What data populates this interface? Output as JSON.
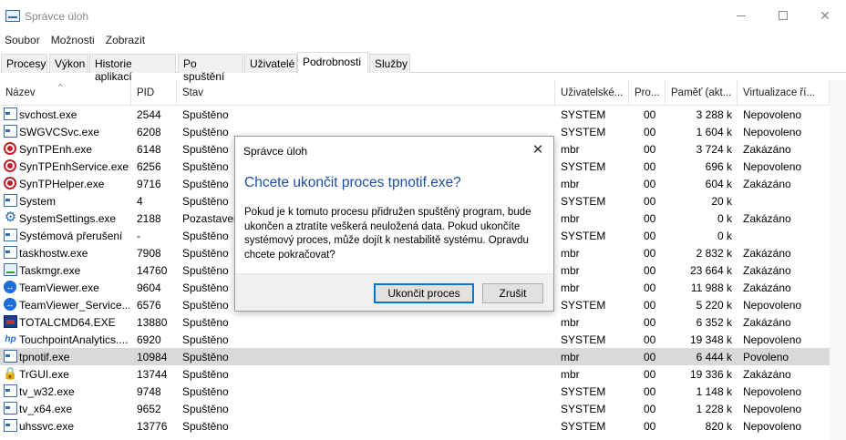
{
  "window": {
    "title": "Správce úloh",
    "icons": {
      "app": "task-manager-icon",
      "minimize": "minimize-icon",
      "maximize": "maximize-icon",
      "close": "close-icon"
    }
  },
  "menu": [
    "Soubor",
    "Možnosti",
    "Zobrazit"
  ],
  "tabs": [
    {
      "label": "Procesy",
      "active": false
    },
    {
      "label": "Výkon",
      "active": false
    },
    {
      "label": "Historie aplikací",
      "active": false
    },
    {
      "label": "Po spuštění",
      "active": false
    },
    {
      "label": "Uživatelé",
      "active": false
    },
    {
      "label": "Podrobnosti",
      "active": true
    },
    {
      "label": "Služby",
      "active": false
    }
  ],
  "columns": [
    "Název",
    "PID",
    "Stav",
    "Uživatelské...",
    "Pro...",
    "Paměť (akt...",
    "Virtualizace ří..."
  ],
  "sort": {
    "column": "Název",
    "indicator": "^"
  },
  "rows": [
    {
      "icon": "exe",
      "name": "svchost.exe",
      "pid": "2544",
      "status": "Spuštěno",
      "user": "SYSTEM",
      "cpu": "00",
      "mem": "3 288 k",
      "virt": "Nepovoleno"
    },
    {
      "icon": "exe",
      "name": "SWGVCSvc.exe",
      "pid": "6208",
      "status": "Spuštěno",
      "user": "SYSTEM",
      "cpu": "00",
      "mem": "1 604 k",
      "virt": "Nepovoleno"
    },
    {
      "icon": "syn",
      "name": "SynTPEnh.exe",
      "pid": "6148",
      "status": "Spuštěno",
      "user": "mbr",
      "cpu": "00",
      "mem": "3 724 k",
      "virt": "Zakázáno"
    },
    {
      "icon": "syn",
      "name": "SynTPEnhService.exe",
      "pid": "6256",
      "status": "Spuštěno",
      "user": "SYSTEM",
      "cpu": "00",
      "mem": "696 k",
      "virt": "Nepovoleno"
    },
    {
      "icon": "syn",
      "name": "SynTPHelper.exe",
      "pid": "9716",
      "status": "Spuštěno",
      "user": "mbr",
      "cpu": "00",
      "mem": "604 k",
      "virt": "Zakázáno"
    },
    {
      "icon": "exe",
      "name": "System",
      "pid": "4",
      "status": "Spuštěno",
      "user": "SYSTEM",
      "cpu": "00",
      "mem": "20 k",
      "virt": ""
    },
    {
      "icon": "gear",
      "name": "SystemSettings.exe",
      "pid": "2188",
      "status": "Pozastaven",
      "user": "mbr",
      "cpu": "00",
      "mem": "0 k",
      "virt": "Zakázáno"
    },
    {
      "icon": "exe",
      "name": "Systémová přerušení",
      "pid": "-",
      "status": "Spuštěno",
      "user": "SYSTEM",
      "cpu": "00",
      "mem": "0 k",
      "virt": ""
    },
    {
      "icon": "exe",
      "name": "taskhostw.exe",
      "pid": "7908",
      "status": "Spuštěno",
      "user": "mbr",
      "cpu": "00",
      "mem": "2 832 k",
      "virt": "Zakázáno"
    },
    {
      "icon": "mgr",
      "name": "Taskmgr.exe",
      "pid": "14760",
      "status": "Spuštěno",
      "user": "mbr",
      "cpu": "00",
      "mem": "23 664 k",
      "virt": "Zakázáno"
    },
    {
      "icon": "tv",
      "name": "TeamViewer.exe",
      "pid": "9604",
      "status": "Spuštěno",
      "user": "mbr",
      "cpu": "00",
      "mem": "11 988 k",
      "virt": "Zakázáno"
    },
    {
      "icon": "tv",
      "name": "TeamViewer_Service....",
      "pid": "6576",
      "status": "Spuštěno",
      "user": "SYSTEM",
      "cpu": "00",
      "mem": "5 220 k",
      "virt": "Nepovoleno"
    },
    {
      "icon": "tc",
      "name": "TOTALCMD64.EXE",
      "pid": "13880",
      "status": "Spuštěno",
      "user": "mbr",
      "cpu": "00",
      "mem": "6 352 k",
      "virt": "Zakázáno"
    },
    {
      "icon": "hp",
      "name": "TouchpointAnalytics....",
      "pid": "6920",
      "status": "Spuštěno",
      "user": "SYSTEM",
      "cpu": "00",
      "mem": "19 348 k",
      "virt": "Nepovoleno"
    },
    {
      "icon": "exe",
      "name": "tpnotif.exe",
      "pid": "10984",
      "status": "Spuštěno",
      "user": "mbr",
      "cpu": "00",
      "mem": "6 444 k",
      "virt": "Povoleno",
      "selected": true
    },
    {
      "icon": "lock",
      "name": "TrGUI.exe",
      "pid": "13744",
      "status": "Spuštěno",
      "user": "mbr",
      "cpu": "00",
      "mem": "19 336 k",
      "virt": "Zakázáno"
    },
    {
      "icon": "exe",
      "name": "tv_w32.exe",
      "pid": "9748",
      "status": "Spuštěno",
      "user": "SYSTEM",
      "cpu": "00",
      "mem": "1 148 k",
      "virt": "Nepovoleno"
    },
    {
      "icon": "exe",
      "name": "tv_x64.exe",
      "pid": "9652",
      "status": "Spuštěno",
      "user": "SYSTEM",
      "cpu": "00",
      "mem": "1 228 k",
      "virt": "Nepovoleno"
    },
    {
      "icon": "exe",
      "name": "uhssvc.exe",
      "pid": "13776",
      "status": "Spuštěno",
      "user": "SYSTEM",
      "cpu": "00",
      "mem": "820 k",
      "virt": "Nepovoleno"
    }
  ],
  "dialog": {
    "title": "Správce úloh",
    "heading": "Chcete ukončit proces tpnotif.exe?",
    "body": "Pokud je k tomuto procesu přidružen spuštěný program, bude ukončen a ztratíte veškerá neuložená data. Pokud ukončíte systémový proces, může dojít k nestabilitě systému. Opravdu chcete pokračovat?",
    "confirm_label": "Ukončit proces",
    "cancel_label": "Zrušit",
    "close_icon": "close-icon"
  },
  "colors": {
    "selected_row": "#d9d9d9",
    "dialog_heading": "#1c4fa0",
    "primary_button_border": "#0078d7"
  }
}
